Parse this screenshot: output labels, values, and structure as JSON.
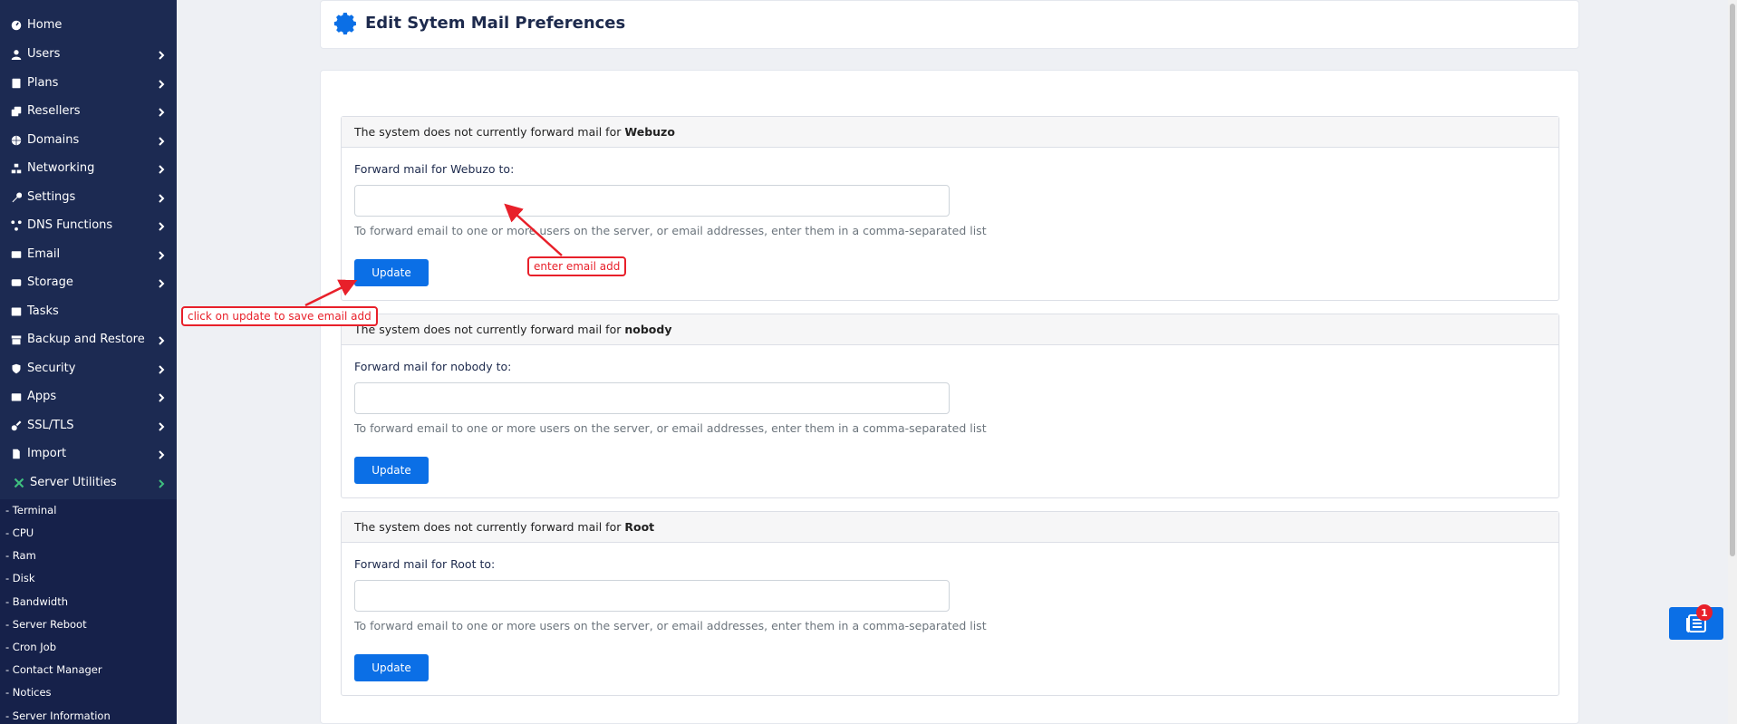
{
  "page_title": "Edit Sytem Mail Preferences",
  "sidebar": {
    "items": [
      {
        "label": "Home",
        "icon": "dashboard-icon",
        "has_chevron": false
      },
      {
        "label": "Users",
        "icon": "user-icon",
        "has_chevron": true
      },
      {
        "label": "Plans",
        "icon": "book-icon",
        "has_chevron": true
      },
      {
        "label": "Resellers",
        "icon": "copy-icon",
        "has_chevron": true
      },
      {
        "label": "Domains",
        "icon": "globe-icon",
        "has_chevron": true
      },
      {
        "label": "Networking",
        "icon": "network-icon",
        "has_chevron": true
      },
      {
        "label": "Settings",
        "icon": "wrench-icon",
        "has_chevron": true
      },
      {
        "label": "DNS Functions",
        "icon": "dns-icon",
        "has_chevron": true
      },
      {
        "label": "Email",
        "icon": "envelope-icon",
        "has_chevron": true
      },
      {
        "label": "Storage",
        "icon": "hdd-icon",
        "has_chevron": true
      },
      {
        "label": "Tasks",
        "icon": "tasks-icon",
        "has_chevron": false
      },
      {
        "label": "Backup and Restore",
        "icon": "archive-icon",
        "has_chevron": true
      },
      {
        "label": "Security",
        "icon": "shield-icon",
        "has_chevron": true
      },
      {
        "label": "Apps",
        "icon": "apps-icon",
        "has_chevron": true
      },
      {
        "label": "SSL/TLS",
        "icon": "key-icon",
        "has_chevron": true
      },
      {
        "label": "Import",
        "icon": "import-icon",
        "has_chevron": true
      },
      {
        "label": "Server Utilities",
        "icon": "tools-icon",
        "has_chevron": true
      }
    ],
    "sub_items": [
      "- Terminal",
      "- CPU",
      "- Ram",
      "- Disk",
      "- Bandwidth",
      "- Server Reboot",
      "- Cron Job",
      "- Contact Manager",
      "- Notices",
      "- Server Information"
    ]
  },
  "sections": [
    {
      "header_prefix": "The system does not currently forward mail for",
      "header_name": "Webuzo",
      "label": "Forward mail for Webuzo to:",
      "value": "",
      "help": "To forward email to one or more users on the server, or email addresses, enter them in a comma-separated list",
      "button": "Update"
    },
    {
      "header_prefix": "The system does not currently forward mail for",
      "header_name": "nobody",
      "label": "Forward mail for nobody to:",
      "value": "",
      "help": "To forward email to one or more users on the server, or email addresses, enter them in a comma-separated list",
      "button": "Update"
    },
    {
      "header_prefix": "The system does not currently forward mail for",
      "header_name": "Root",
      "label": "Forward mail for Root to:",
      "value": "",
      "help": "To forward email to one or more users on the server, or email addresses, enter them in a comma-separated list",
      "button": "Update"
    }
  ],
  "annotations": {
    "enter_email": "enter email add",
    "click_update": "click on update to save email add"
  },
  "notifications": {
    "count": "1"
  },
  "colors": {
    "sidebar_bg": "#1c2a52",
    "primary": "#0b6fe6",
    "annotation": "#e8202a",
    "active_accent": "#3fbf7f"
  }
}
